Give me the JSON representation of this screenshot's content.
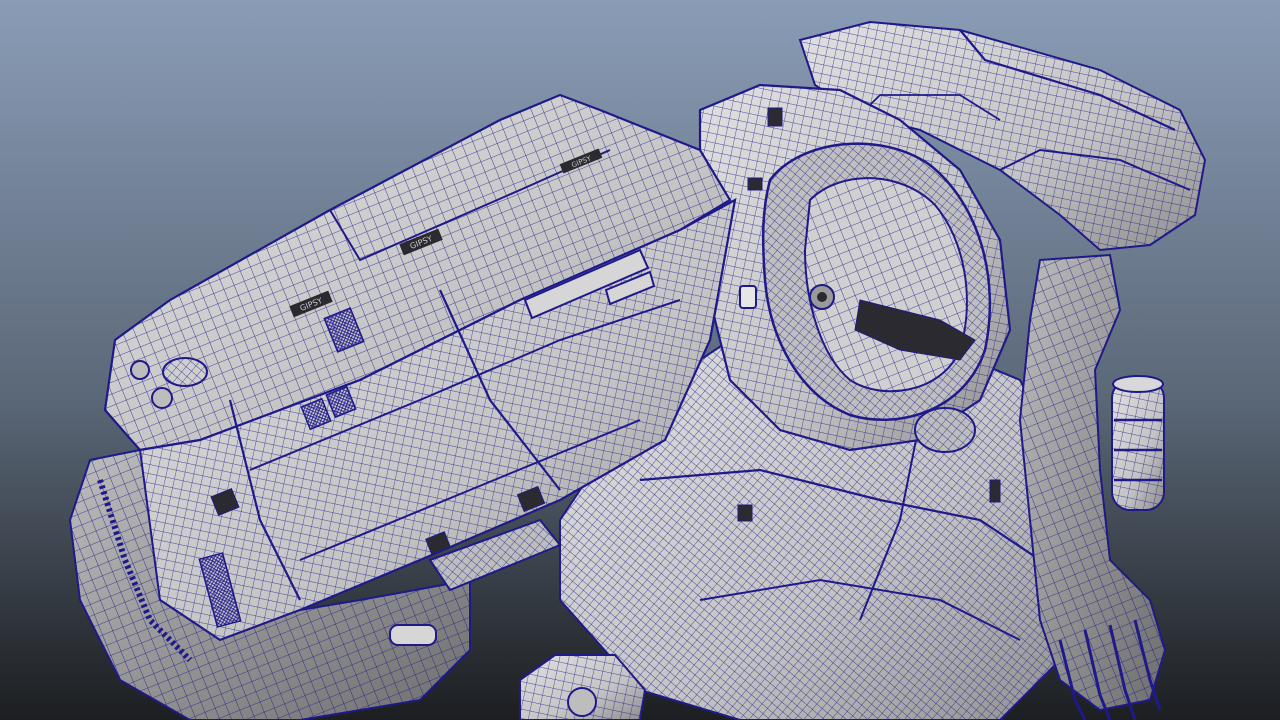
{
  "viewport": {
    "background_top": "#8a9cb6",
    "background_mid": "#5b6878",
    "background_bottom": "#1c1e21",
    "wire_color": "#1f1a8a",
    "surface_color": "#c9c9c9",
    "surface_shadow": "#7a7a7a",
    "surface_dark": "#2a2a30"
  },
  "model": {
    "decals": [
      {
        "id": "decal-arm-top",
        "text": "GIPSY"
      },
      {
        "id": "decal-arm-mid",
        "text": "GIPSY"
      },
      {
        "id": "decal-arm-low",
        "text": "GIPSY"
      }
    ]
  }
}
